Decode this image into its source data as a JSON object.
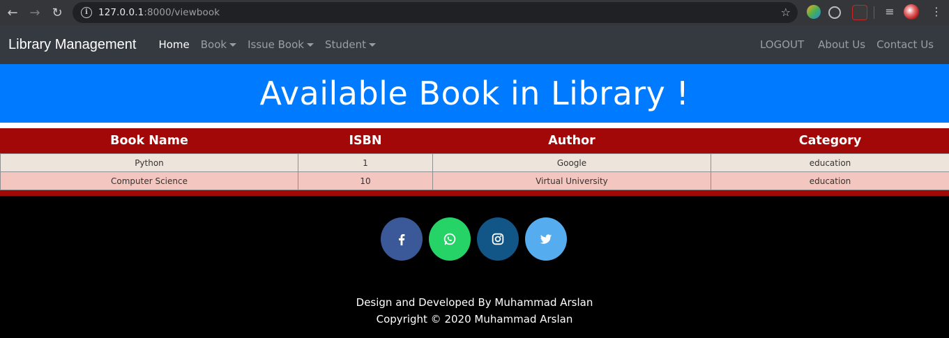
{
  "browser": {
    "url_host": "127.0.0.1",
    "url_rest": ":8000/viewbook",
    "icons": [
      "back-arrow-icon",
      "forward-arrow-icon",
      "reload-icon",
      "info-icon",
      "star-icon",
      "extension-icons",
      "profile-avatar",
      "menu-dots-icon"
    ]
  },
  "navbar": {
    "brand": "Library Management",
    "items": [
      {
        "label": "Home",
        "active": true
      },
      {
        "label": "Book",
        "dropdown": true
      },
      {
        "label": "Issue Book",
        "dropdown": true
      },
      {
        "label": "Student",
        "dropdown": true
      }
    ],
    "right": [
      "LOGOUT",
      "About Us",
      "Contact Us"
    ]
  },
  "hero": {
    "title": "Available Book in Library !"
  },
  "table": {
    "headers": [
      "Book Name",
      "ISBN",
      "Author",
      "Category"
    ],
    "rows": [
      [
        "Python",
        "1",
        "Google",
        "education"
      ],
      [
        "Computer Science",
        "10",
        "Virtual University",
        "education"
      ]
    ]
  },
  "footer": {
    "social": [
      {
        "name": "facebook",
        "color": "#3b5998"
      },
      {
        "name": "whatsapp",
        "color": "#25d366"
      },
      {
        "name": "instagram",
        "color": "#125688"
      },
      {
        "name": "twitter",
        "color": "#55acee"
      }
    ],
    "line1": "Design and Developed By Muhammad Arslan",
    "line2": "Copyright © 2020 Muhammad Arslan"
  },
  "colors": {
    "navbar": "#343a40",
    "hero": "#007bff",
    "table_header": "#a30808",
    "row_odd": "#ede5dc",
    "row_even": "#f3c6bf"
  }
}
